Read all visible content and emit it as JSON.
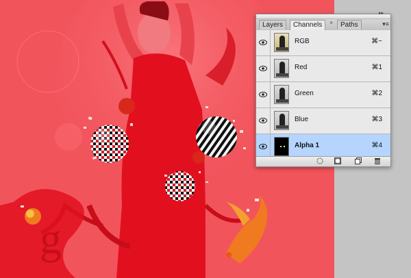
{
  "panel": {
    "tabs": [
      "Layers",
      "Channels",
      "Paths"
    ],
    "active_tab": "Channels",
    "tab_close_glyph": "×",
    "collapse_glyph": "▸▸",
    "menu_glyph": "▾≡",
    "channels": [
      {
        "name": "RGB",
        "shortcut": "⌘~",
        "thumb": "color",
        "selected": false
      },
      {
        "name": "Red",
        "shortcut": "⌘1",
        "thumb": "gray",
        "selected": false
      },
      {
        "name": "Green",
        "shortcut": "⌘2",
        "thumb": "gray",
        "selected": false
      },
      {
        "name": "Blue",
        "shortcut": "⌘3",
        "thumb": "gray",
        "selected": false
      },
      {
        "name": "Alpha 1",
        "shortcut": "⌘4",
        "thumb": "dark",
        "selected": true
      }
    ],
    "footer_icons": [
      "load-selection-icon",
      "save-selection-icon",
      "new-channel-icon",
      "trash-icon"
    ]
  },
  "canvas": {
    "text": "g",
    "background": "#f2545c",
    "accent": "#d61a28"
  }
}
